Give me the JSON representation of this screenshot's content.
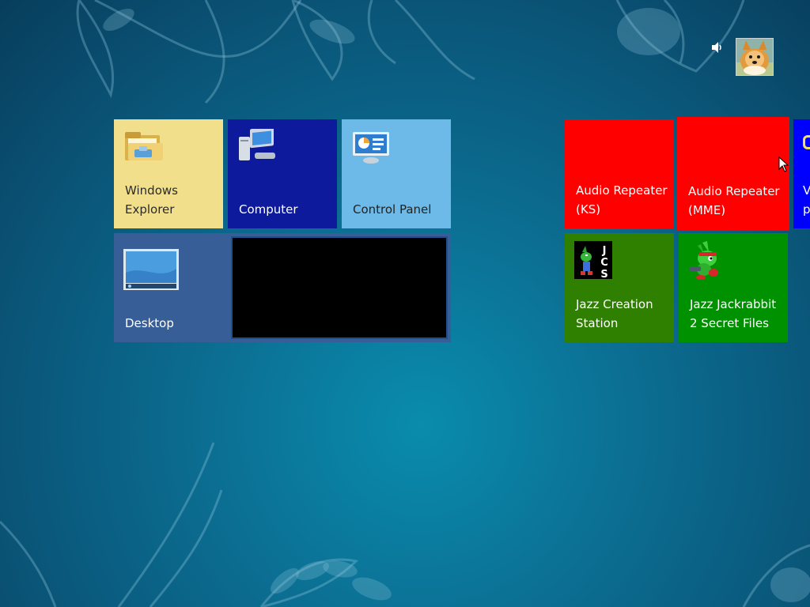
{
  "screen": "start",
  "tiles": {
    "windows_explorer": {
      "label": "Windows\nExplorer",
      "color": "#f1df8c"
    },
    "computer": {
      "label": "Computer",
      "color": "#0d1a9c"
    },
    "control_panel": {
      "label": "Control Panel",
      "color": "#6dbae8"
    },
    "desktop": {
      "label": "Desktop",
      "color": "#375e96"
    },
    "audio_repeater_ks": {
      "label": "Audio Repeater\n(KS)",
      "color": "#ff0000"
    },
    "audio_repeater_mme": {
      "label": "Audio Repeater\n(MME)",
      "color": "#ff0000"
    },
    "partial_tile": {
      "label": "V\np",
      "color": "#0000ff"
    },
    "jazz_creation_station": {
      "label": "Jazz Creation\nStation",
      "color": "#2f7f00",
      "icon_text": "JCS"
    },
    "jazz_jackrabbit": {
      "label": "Jazz Jackrabbit\n2 Secret Files",
      "color": "#009100"
    }
  },
  "user": {
    "avatar": "user-avatar-pomeranian",
    "volume_icon": "speaker-icon"
  }
}
